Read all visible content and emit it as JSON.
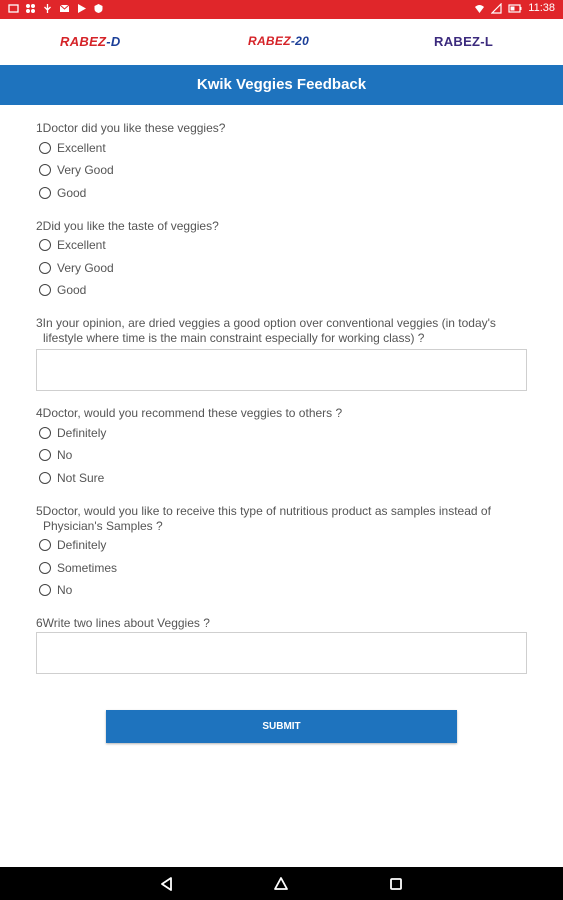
{
  "status_bar": {
    "time": "11:38"
  },
  "brands": [
    {
      "main": "RABEZ",
      "suffix": "-D"
    },
    {
      "main": "RABEZ",
      "suffix": "-20"
    },
    {
      "main": "RABEZ",
      "suffix": "-L"
    }
  ],
  "header": {
    "title": "Kwik Veggies Feedback"
  },
  "questions": [
    {
      "line1": "1Doctor did you like these veggies?",
      "options": [
        "Excellent",
        "Very Good",
        "Good"
      ]
    },
    {
      "line1": "2Did you like the taste of veggies?",
      "options": [
        "Excellent",
        "Very Good",
        "Good"
      ]
    },
    {
      "line1": "3In your opinion, are dried veggies a good option over conventional veggies (in today's",
      "line2": "lifestyle where time is the main constraint especially for working class) ?"
    },
    {
      "line1": "4Doctor, would you  recommend these veggies to others ?",
      "options": [
        "Definitely",
        "No",
        "Not Sure"
      ]
    },
    {
      "line1": "5Doctor, would you like to receive this type of nutritious product as samples instead of",
      "line2": "Physician's Samples ?",
      "options": [
        "Definitely",
        "Sometimes",
        "No"
      ]
    },
    {
      "line1": "6Write two lines about Veggies ?"
    }
  ],
  "submit_label": "SUBMIT",
  "colors": {
    "status_bar": "#e0262a",
    "header": "#1e73be",
    "submit": "#1e73be"
  }
}
